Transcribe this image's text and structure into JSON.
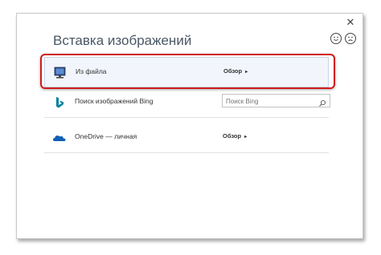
{
  "dialog": {
    "title": "Вставка изображений",
    "close_glyph": "✕"
  },
  "feedback": {
    "happy": "smile-face",
    "sad": "frown-face"
  },
  "rows": [
    {
      "label": "Из файла",
      "action_label": "Обзор",
      "action_arrow": "▸",
      "icon": "computer-monitor-icon"
    },
    {
      "label": "Поиск изображений Bing",
      "search_placeholder": "Поиск Bing",
      "icon": "bing-icon"
    },
    {
      "label": "OneDrive — личная",
      "action_label": "Обзор",
      "action_arrow": "▸",
      "icon": "onedrive-cloud-icon"
    }
  ],
  "colors": {
    "highlight": "#d11b1b",
    "bing": "#00809d",
    "onedrive": "#0f5fb5"
  }
}
